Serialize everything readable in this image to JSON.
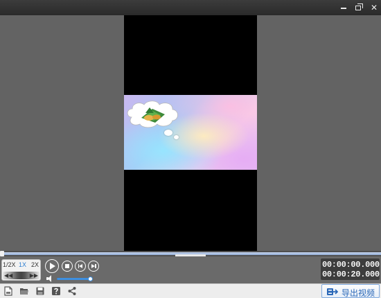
{
  "window": {
    "icons": [
      "minimize-icon",
      "restore-icon",
      "close-icon"
    ],
    "close_glyph": "✕"
  },
  "preview": {
    "frame_description_icon": "thought-bubble-sticker"
  },
  "timeline": {
    "progress": 0.0
  },
  "speed": {
    "options": [
      "1/2X",
      "1X",
      "2X"
    ],
    "selected": "1X",
    "left_arrow": "◀◀",
    "right_arrow": "▶▶"
  },
  "playback": {
    "current_time": "00:00:00.000",
    "total_time": "00:00:20.000"
  },
  "volume": {
    "level": 1.0
  },
  "collapse": {
    "glyph": "⌄"
  },
  "toolbar": {
    "icons": [
      "new-file-icon",
      "open-folder-icon",
      "save-icon",
      "help-icon",
      "share-icon"
    ],
    "export_label": "导出视频"
  },
  "colors": {
    "accent": "#3e8fe0",
    "export_text": "#2a68b8",
    "selected_speed": "#2f7fd2"
  }
}
